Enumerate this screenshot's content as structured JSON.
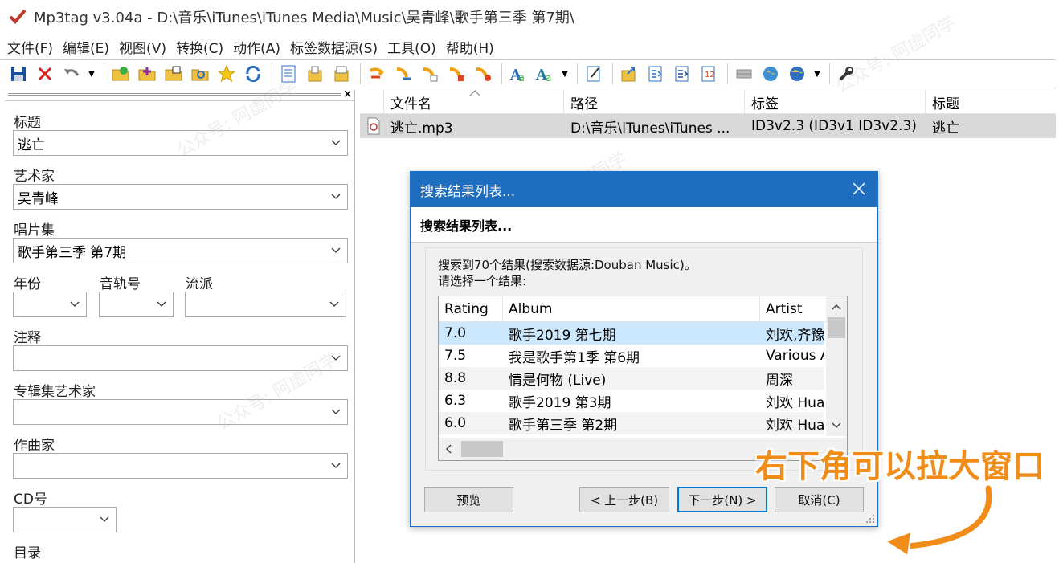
{
  "window": {
    "title": "Mp3tag v3.04a  -  D:\\音乐\\iTunes\\iTunes Media\\Music\\吴青峰\\歌手第三季 第7期\\"
  },
  "menu": [
    "文件(F)",
    "编辑(E)",
    "视图(V)",
    "转换(C)",
    "动作(A)",
    "标签数据源(S)",
    "工具(O)",
    "帮助(H)"
  ],
  "tag_panel": {
    "title_label": "标题",
    "title_value": "逃亡",
    "artist_label": "艺术家",
    "artist_value": "吴青峰",
    "album_label": "唱片集",
    "album_value": "歌手第三季 第7期",
    "year_label": "年份",
    "year_value": "",
    "track_label": "音轨号",
    "track_value": "",
    "genre_label": "流派",
    "genre_value": "",
    "comment_label": "注释",
    "comment_value": "",
    "album_artist_label": "专辑集艺术家",
    "album_artist_value": "",
    "composer_label": "作曲家",
    "composer_value": "",
    "cd_label": "CD号",
    "cd_value": "",
    "directory_label": "目录"
  },
  "file_list": {
    "columns": [
      "文件名",
      "路径",
      "标签",
      "标题"
    ],
    "rows": [
      {
        "filename": "逃亡.mp3",
        "path": "D:\\音乐\\iTunes\\iTunes ...",
        "tag": "ID3v2.3 (ID3v1 ID3v2.3)",
        "title": "逃亡"
      }
    ]
  },
  "dialog": {
    "title": "搜索结果列表...",
    "header": "搜索结果列表...",
    "info_line1": "搜索到70个结果(搜索数据源:Douban Music)。",
    "info_line2": "请选择一个结果:",
    "columns": [
      "Rating",
      "Album",
      "Artist"
    ],
    "results": [
      {
        "rating": "7.0",
        "album": "歌手2019 第七期",
        "artist": "刘欢,齐豫"
      },
      {
        "rating": "7.5",
        "album": "我是歌手第1季 第6期",
        "artist": "Various A"
      },
      {
        "rating": "8.8",
        "album": "情是何物 (Live)",
        "artist": "周深"
      },
      {
        "rating": "6.3",
        "album": "歌手2019 第3期",
        "artist": "刘欢 Hua"
      },
      {
        "rating": "6.0",
        "album": "歌手第三季 第2期",
        "artist": "刘欢 Hua"
      }
    ],
    "buttons": {
      "preview": "预览",
      "back": "< 上一步(B)",
      "next": "下一步(N) >",
      "cancel": "取消(C)"
    }
  },
  "annotation": {
    "text": "右下角可以拉大窗口"
  },
  "watermark": {
    "text": "公众号: 阿虚同学"
  },
  "colors": {
    "dialog_title_bg": "#1e6dbf",
    "selection": "#cce8ff",
    "annotation": "#f28c18",
    "file_row_bg": "#d9d9d9"
  }
}
